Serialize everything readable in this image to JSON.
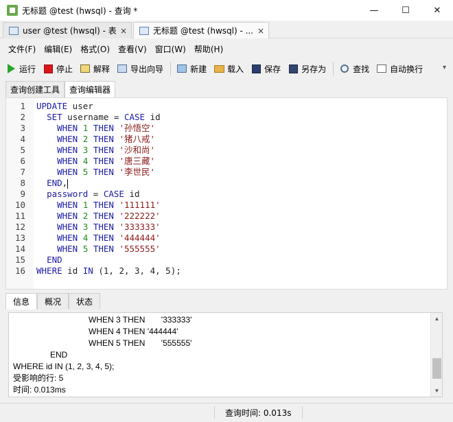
{
  "window": {
    "title": "无标题 @test (hwsql) - 查询 *",
    "controls": {
      "minimize": "—",
      "maximize": "☐",
      "close": "✕"
    }
  },
  "doc_tabs": [
    {
      "label": "user @test (hwsql) - 表",
      "close": "×",
      "active": false
    },
    {
      "label": "无标题 @test (hwsql) - ...",
      "close": "×",
      "active": true
    }
  ],
  "menu": [
    "文件(F)",
    "编辑(E)",
    "格式(O)",
    "查看(V)",
    "窗口(W)",
    "帮助(H)"
  ],
  "toolbar": {
    "run": "运行",
    "stop": "停止",
    "explain": "解释",
    "export_wizard": "导出向导",
    "new": "新建",
    "load": "载入",
    "save": "保存",
    "save_as": "另存为",
    "find": "查找",
    "word_wrap": "自动换行",
    "overflow": "▾"
  },
  "editor_tabs": [
    "查询创建工具",
    "查询编辑器"
  ],
  "sql_lines": [
    {
      "n": "1",
      "kw1": "UPDATE",
      "rest": " user"
    },
    {
      "n": "2",
      "kw1": "SET",
      "rest": " username = ",
      "kw2": "CASE",
      "rest2": " id"
    },
    {
      "n": "3",
      "kw1": "WHEN",
      "num": "1",
      "kw2": "THEN",
      "str": "'孙悟空'"
    },
    {
      "n": "4",
      "kw1": "WHEN",
      "num": "2",
      "kw2": "THEN",
      "str": "'猪八戒'"
    },
    {
      "n": "5",
      "kw1": "WHEN",
      "num": "3",
      "kw2": "THEN",
      "str": "'沙和尚'"
    },
    {
      "n": "6",
      "kw1": "WHEN",
      "num": "4",
      "kw2": "THEN",
      "str": "'唐三藏'"
    },
    {
      "n": "7",
      "kw1": "WHEN",
      "num": "5",
      "kw2": "THEN",
      "str": "'李世民'"
    },
    {
      "n": "8",
      "kw1": "END",
      "rest": ","
    },
    {
      "n": "9",
      "kw1": "password",
      "rest": " = ",
      "kw2": "CASE",
      "rest2": " id"
    },
    {
      "n": "10",
      "kw1": "WHEN",
      "num": "1",
      "kw2": "THEN",
      "str": "'111111'"
    },
    {
      "n": "11",
      "kw1": "WHEN",
      "num": "2",
      "kw2": "THEN",
      "str": "'222222'"
    },
    {
      "n": "12",
      "kw1": "WHEN",
      "num": "3",
      "kw2": "THEN",
      "str": "'333333'"
    },
    {
      "n": "13",
      "kw1": "WHEN",
      "num": "4",
      "kw2": "THEN",
      "str": "'444444'"
    },
    {
      "n": "14",
      "kw1": "WHEN",
      "num": "5",
      "kw2": "THEN",
      "str": "'555555'"
    },
    {
      "n": "15",
      "kw1": "END"
    },
    {
      "n": "16",
      "kw1": "WHERE",
      "rest": " id ",
      "kw2": "IN",
      "rest2": " (1, 2, 3, 4, 5);"
    }
  ],
  "result_tabs": [
    "信息",
    "概况",
    "状态"
  ],
  "output_lines": [
    "WHEN 3 THEN       '333333'",
    "WHEN 4 THEN '444444'",
    "WHEN 5 THEN       '555555'",
    "END",
    "WHERE id IN (1, 2, 3, 4, 5);",
    "受影响的行: 5",
    "时间: 0.013ms"
  ],
  "status": {
    "query_time": "查询时间: 0.013s"
  }
}
